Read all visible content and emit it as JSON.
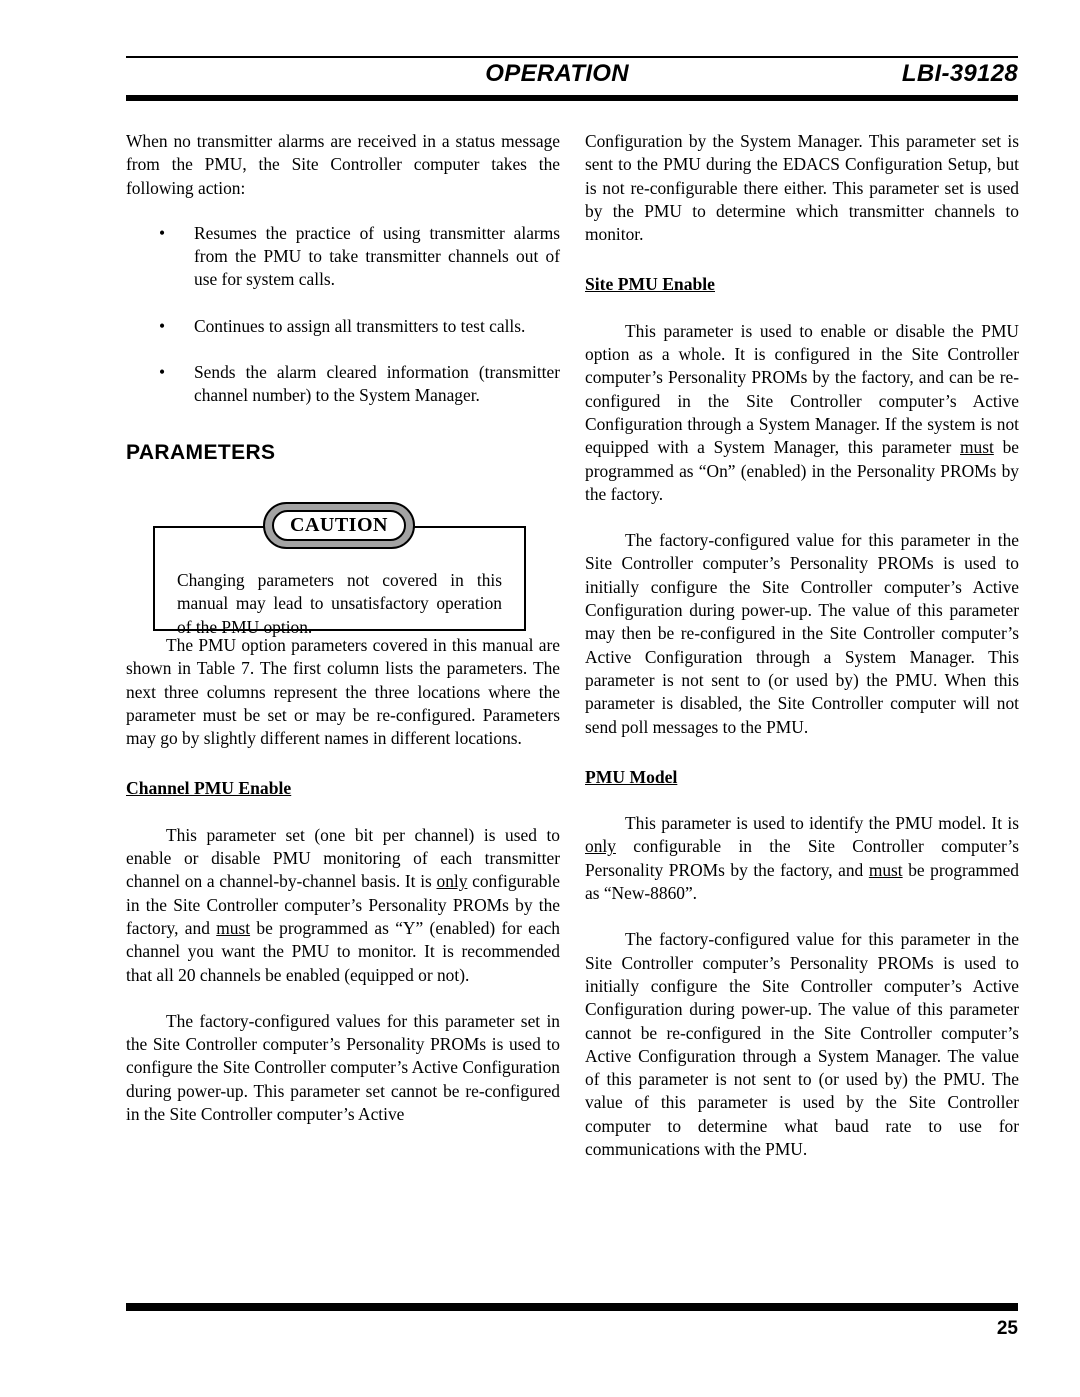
{
  "header": {
    "title": "OPERATION",
    "document_id": "LBI-39128",
    "rule_color": "#000000"
  },
  "footer": {
    "page_number": "25"
  },
  "left_column": {
    "intro_paragraph": "When no transmitter alarms are received in a status message from the PMU, the Site Controller computer takes the following action:",
    "bullet_marker": "•",
    "bullets": [
      "Resumes the practice of using transmitter alarms from the PMU to take transmitter channels out of use for system calls.",
      "Continues to assign all transmitters to test calls.",
      "Sends the alarm cleared information (transmitter channel number) to the System Manager."
    ],
    "section_heading": "PARAMETERS",
    "caution": {
      "badge_label": "CAUTION",
      "badge_fill": "#a3a3a3",
      "body": "Changing parameters not covered in this manual may lead to unsatisfactory operation of the PMU option."
    },
    "table_paragraph": "The PMU option parameters covered in this manual are shown in Table 7. The first column lists the parameters. The next three columns represent the three locations where the parameter must be set or may be re-configured. Parameters may go by slightly different names in different locations.",
    "channel_pmu_enable": {
      "heading": "Channel PMU Enable",
      "para1_part1": "This parameter set (one bit per channel) is used to enable or disable PMU monitoring of each transmitter channel on a channel-by-channel basis. It is ",
      "para1_emph1": "only",
      "para1_part2": " configurable in the Site Controller computer’s Personality PROMs by the factory, and ",
      "para1_emph2": "must",
      "para1_part3": " be programmed as “Y” (enabled) for each channel you want the PMU to monitor. It is recommended that all 20 channels be enabled (equipped or not).",
      "para2": "The factory-configured values for this parameter set in the Site Controller computer’s Personality PROMs is used to configure the Site Controller computer’s Active Configuration during power-up. This parameter set cannot be re-configured in the Site Controller computer’s Active"
    }
  },
  "right_column": {
    "continuation_paragraph": "Configuration by the System Manager. This parameter set is sent to the PMU during the EDACS Configuration Setup, but is not re-configurable there either. This parameter set is used by the PMU to determine which transmitter channels to monitor.",
    "site_pmu_enable": {
      "heading": "Site PMU Enable",
      "para1_part1": "This parameter is used to enable or disable the PMU option as a whole. It is configured in the Site Controller computer’s Personality PROMs by the factory, and can be re-configured in the Site Controller computer’s Active Configuration through a System Manager. If the system is not equipped with a System Manager, this parameter ",
      "para1_emph1": "must",
      "para1_part2": " be programmed as “On” (enabled) in the Personality PROMs by the factory.",
      "para2": "The factory-configured value for this parameter in the Site Controller computer’s Personality PROMs is used to initially configure the Site Controller computer’s Active Configuration during power-up. The value of this parameter may then be re-configured in the Site Controller computer’s Active Configuration through a System Manager. This parameter is not sent to (or used by) the PMU. When this parameter is disabled, the Site Controller computer will not send poll messages to the PMU."
    },
    "pmu_model": {
      "heading": "PMU Model",
      "para1_part1": "This parameter is used to identify the PMU model. It is ",
      "para1_emph1": "only",
      "para1_part2": " configurable in the Site Controller computer’s Personality PROMs by the factory, and ",
      "para1_emph2": "must",
      "para1_part3": " be programmed as “New-8860”.",
      "para2": "The factory-configured value for this parameter in the Site Controller computer’s Personality PROMs is used to initially configure the Site Controller computer’s Active Configuration during power-up. The value of this parameter cannot be re-configured in the Site Controller computer’s Active Configuration through a System Manager. The value of this parameter is not sent to (or used by) the PMU. The value of this parameter is used by the Site Controller computer to determine what baud rate to use for communications with the PMU."
    }
  }
}
